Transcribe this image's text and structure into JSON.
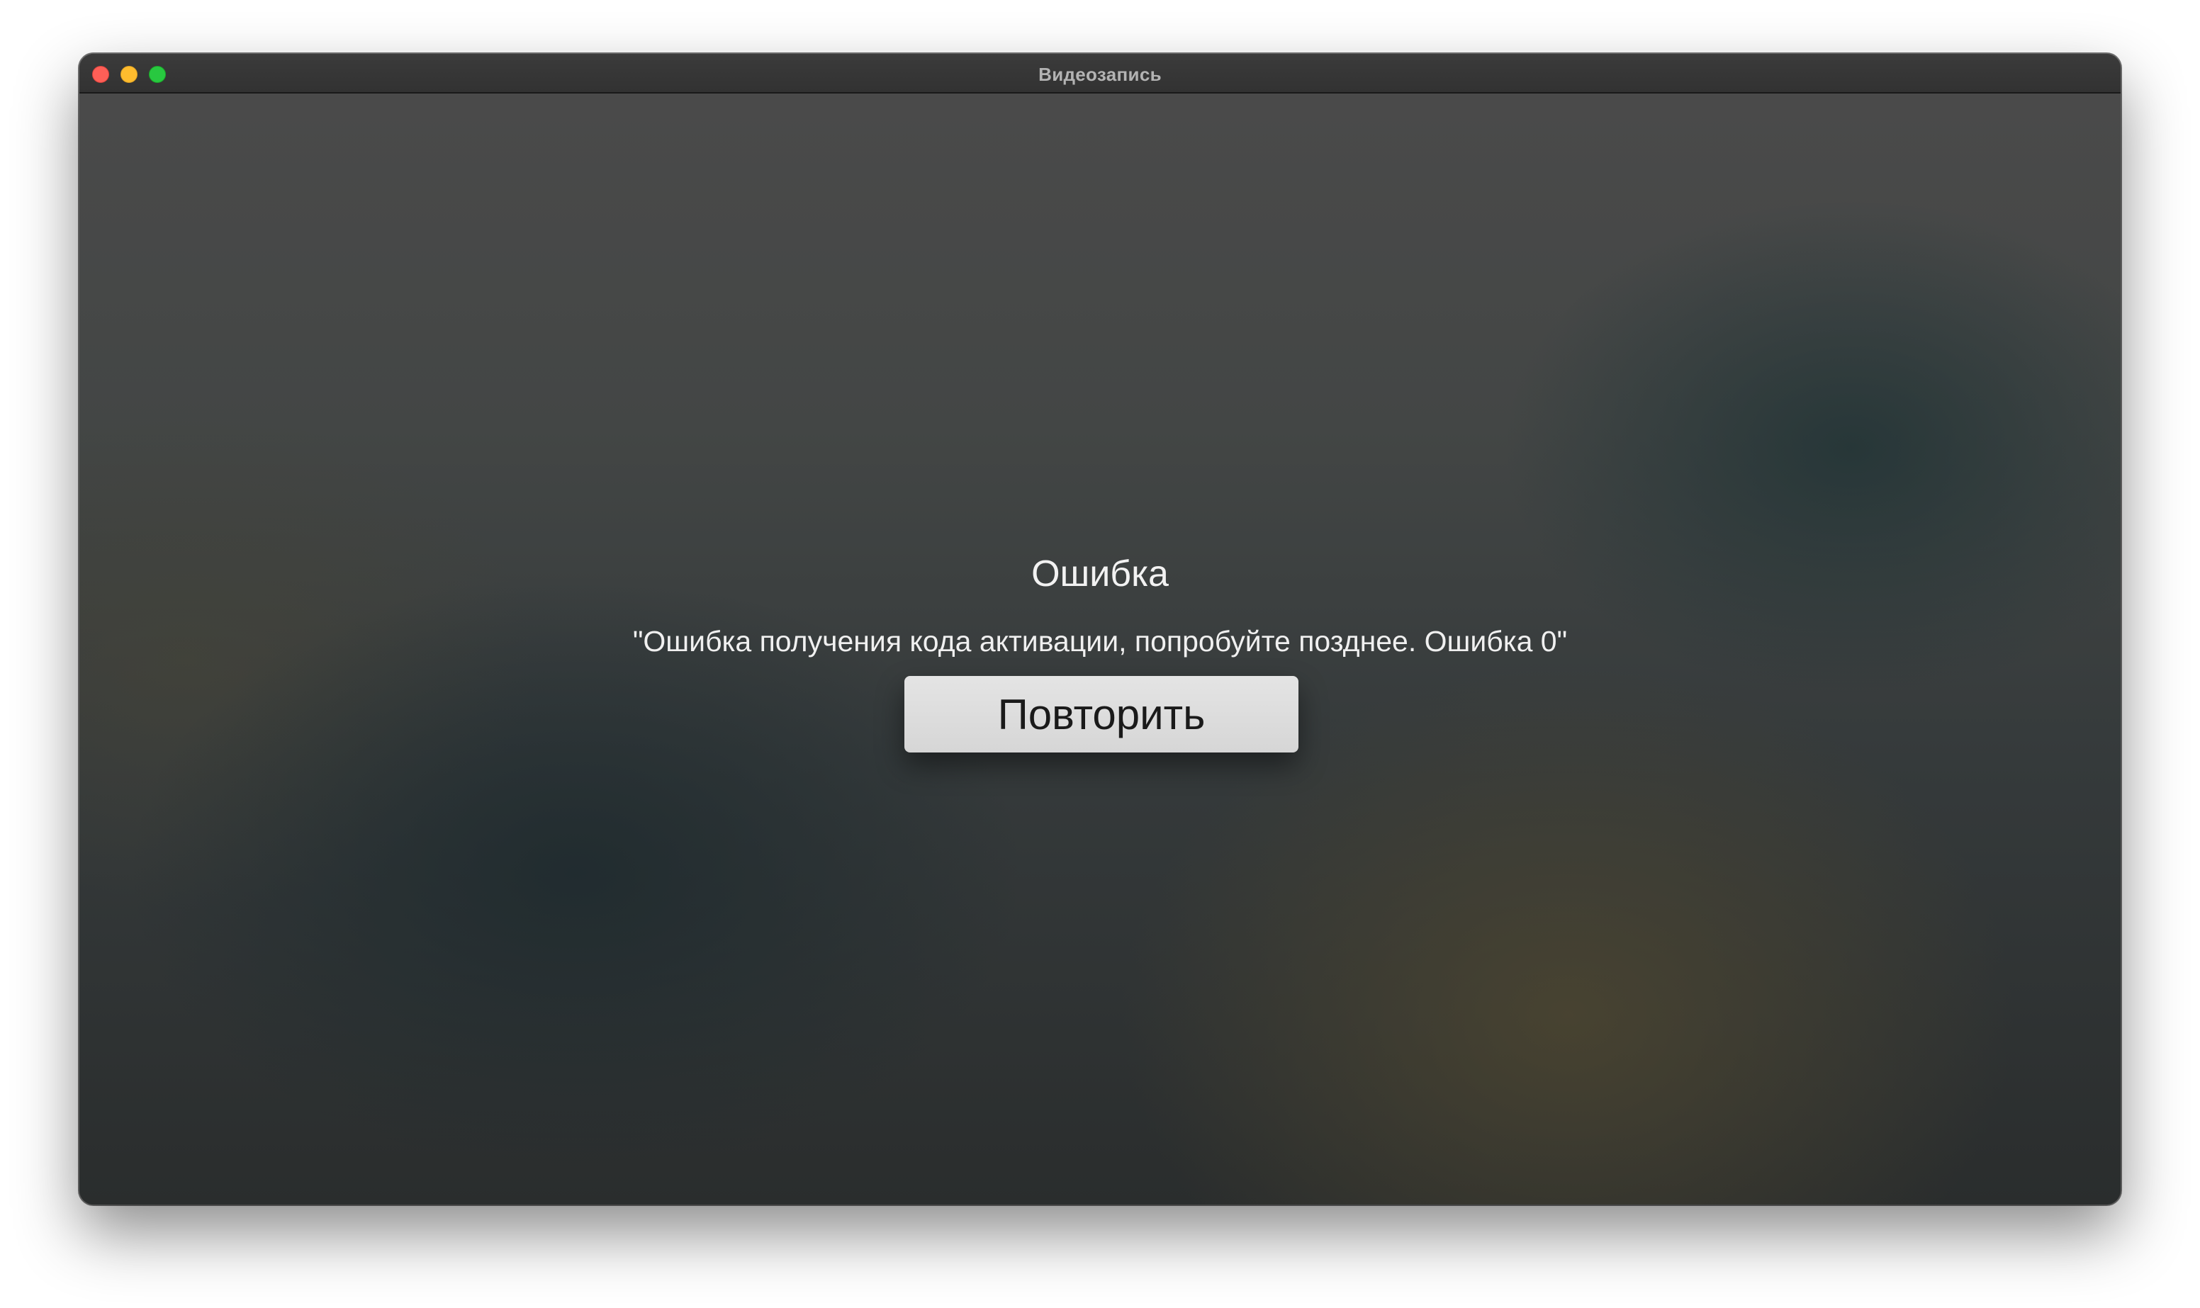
{
  "window": {
    "title": "Видеозапись"
  },
  "traffic_lights": {
    "close_color": "#fe5f57",
    "minimize_color": "#febc2e",
    "zoom_color": "#28c840"
  },
  "error": {
    "title": "Ошибка",
    "message": "\"Ошибка получения кода активации, попробуйте позднее. Ошибка 0\"",
    "retry_label": "Повторить"
  }
}
